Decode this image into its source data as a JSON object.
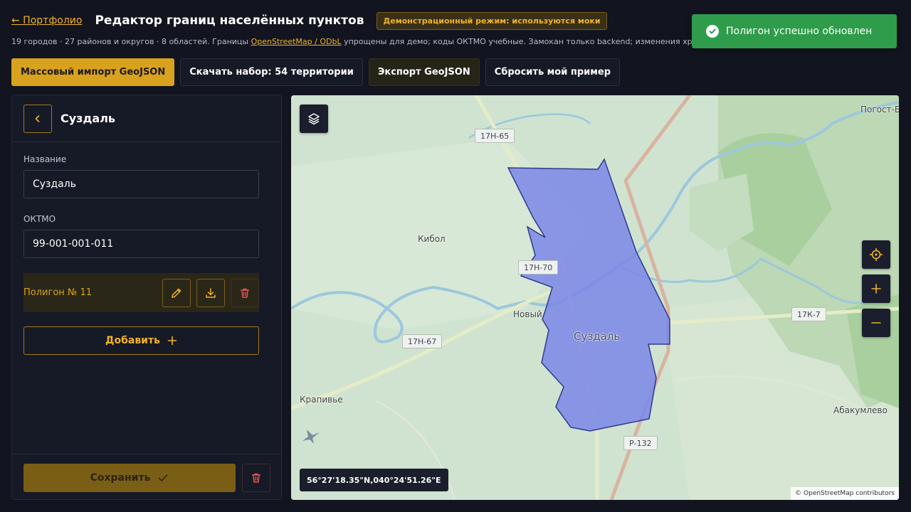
{
  "header": {
    "back_label": "← Портфолио",
    "title": "Редактор границ населённых пунктов",
    "demo_badge": "Демонстрационный режим: используются моки"
  },
  "subtitle": {
    "before_link": "19 городов · 27 районов и округов · 8 областей. Границы ",
    "link": "OpenStreetMap / ODbL",
    "after_link": " упрощены для демо; коды ОКТМО учебные. Замокан только backend; изменения хра"
  },
  "toolbar": {
    "bulk_import": "Массовый импорт GeoJSON",
    "download_set": "Скачать набор: 54 территории",
    "export": "Экспорт GeoJSON",
    "reset": "Сбросить мой пример"
  },
  "toast": {
    "message": "Полигон успешно обновлен"
  },
  "panel": {
    "title": "Суздаль",
    "name_label": "Название",
    "name_value": "Суздаль",
    "oktmo_label": "ОКТМО",
    "oktmo_value": "99-001-001-011",
    "polygon_label": "Полигон № 11",
    "add_label": "Добавить",
    "save_label": "Сохранить"
  },
  "map": {
    "coordinates": "56°27'18.35\"N,040°24'51.26\"E",
    "attribution": "© OpenStreetMap contributors",
    "places": [
      "Погост-Б",
      "Кибол",
      "Новый",
      "Суздаль",
      "Крапивье",
      "Абакумлево"
    ],
    "roads": [
      "17Н-65",
      "17Н-70",
      "17Н-67",
      "17К-7",
      "Р-132"
    ],
    "polygon_fill": "#7b86e8"
  },
  "colors": {
    "accent": "#f0b429",
    "success": "#2e9c4a",
    "danger": "#e05555",
    "background": "#12141f"
  }
}
